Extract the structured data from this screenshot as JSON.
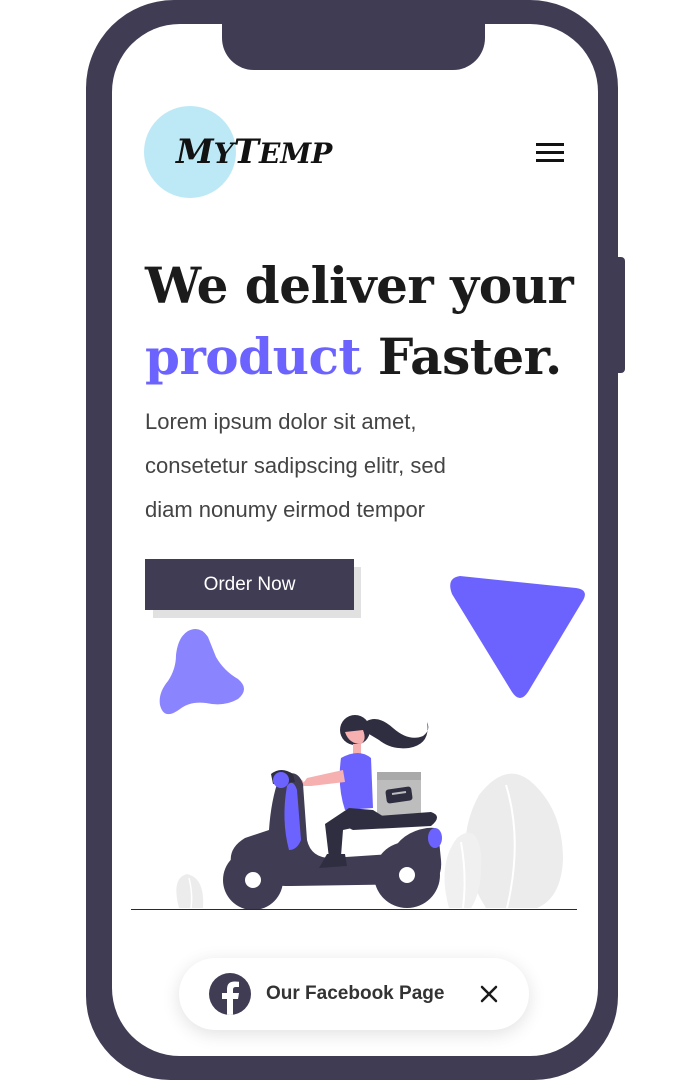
{
  "brand": {
    "logo_first_initial": "M",
    "logo_first_rest": "Y",
    "logo_second_initial": "T",
    "logo_second_rest": "EMP",
    "accent_color": "#6c63ff",
    "dark_color": "#403c54",
    "logo_circle_color": "#bde9f6"
  },
  "header": {
    "menu_icon": "hamburger-menu-icon"
  },
  "hero": {
    "title_line1": "We deliver your",
    "title_accent": "product",
    "title_rest": " Faster.",
    "description_lines": [
      "Lorem ipsum dolor sit amet,",
      "consetetur sadipscing elitr, sed",
      "diam nonumy eirmod tempor"
    ],
    "cta_label": "Order Now"
  },
  "illustration": {
    "subject": "delivery-scooter-rider-illustration"
  },
  "social_bar": {
    "label": "Our Facebook Page",
    "icon": "facebook-icon",
    "close_icon": "close-icon"
  }
}
